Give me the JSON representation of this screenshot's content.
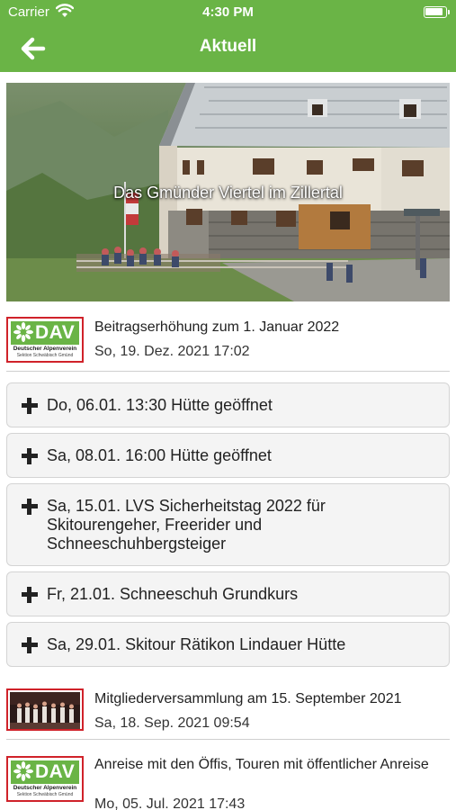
{
  "status_bar": {
    "carrier": "Carrier",
    "time": "4:30 PM"
  },
  "nav": {
    "title": "Aktuell"
  },
  "hero": {
    "caption": "Das Gmünder Viertel im Zillertal"
  },
  "news": [
    {
      "headline": "Beitragserhöhung zum 1. Januar 2022",
      "date": "So, 19. Dez. 2021 17:02",
      "thumb": "dav-logo"
    },
    {
      "headline": "Mitgliederversammlung am 15. September 2021",
      "date": "Sa, 18. Sep. 2021 09:54",
      "thumb": "photo"
    },
    {
      "headline": "Anreise mit den Öffis, Touren mit öffentlicher Anreise",
      "date": "Mo, 05. Jul. 2021 17:43",
      "thumb": "dav-logo"
    }
  ],
  "events": [
    {
      "label": "Do, 06.01. 13:30 Hütte geöffnet"
    },
    {
      "label": "Sa, 08.01. 16:00 Hütte geöffnet"
    },
    {
      "label": "Sa, 15.01. LVS Sicherheitstag 2022 für Skitourengeher, Freerider und Schneeschuhbergsteiger"
    },
    {
      "label": "Fr, 21.01. Schneeschuh Grundkurs"
    },
    {
      "label": "Sa, 29.01. Skitour Rätikon Lindauer Hütte"
    }
  ],
  "dav_logo": {
    "wordmark": "DAV",
    "line1": "Deutscher Alpenverein",
    "line2": "Sektion Schwäbisch Gmünd"
  },
  "colors": {
    "brand_green": "#6ab446",
    "logo_border": "#d0222a",
    "event_bg": "#f4f4f4"
  },
  "icons": {
    "back": "arrow-left-icon",
    "expand": "plus-icon",
    "wifi": "wifi-icon",
    "battery": "battery-icon"
  }
}
